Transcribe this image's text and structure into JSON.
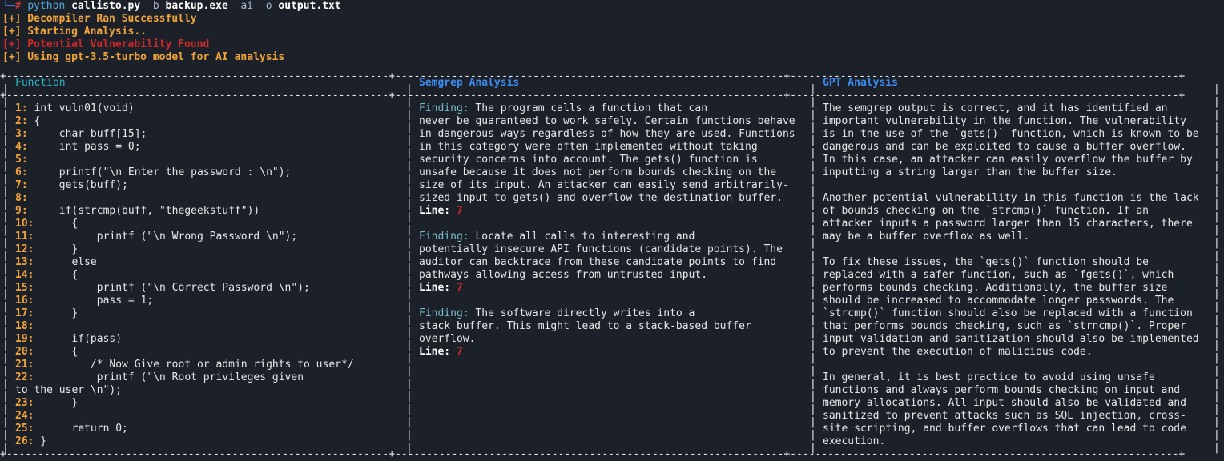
{
  "prompt": {
    "corner": "└─",
    "hash": "#",
    "program": "python",
    "script": "callisto.py",
    "flag_b": "-b",
    "target": "backup.exe",
    "flag_ai": "-ai",
    "flag_o": "-o",
    "outfile": "output.txt"
  },
  "status_messages": [
    {
      "text": "[+] Decompiler Ran Successfully",
      "color": "orange"
    },
    {
      "text": "[+] Starting Analysis..",
      "color": "orange"
    },
    {
      "text": "[+] Potential Vulnerability Found",
      "color": "red"
    },
    {
      "text": "[+] Using gpt-3.5-turbo model for AI analysis",
      "color": "orange"
    }
  ],
  "table": {
    "headers": {
      "function": "Function",
      "semgrep": "Semgrep Analysis",
      "gpt": "GPT Analysis"
    }
  },
  "function_code": [
    {
      "n": "1:",
      "t": " int vuln01(void)"
    },
    {
      "n": "2:",
      "t": " {"
    },
    {
      "n": "3:",
      "t": "     char buff[15];"
    },
    {
      "n": "4:",
      "t": "     int pass = 0;"
    },
    {
      "n": "5:",
      "t": ""
    },
    {
      "n": "6:",
      "t": "     printf(\"\\n Enter the password : \\n\");"
    },
    {
      "n": "7:",
      "t": "     gets(buff);"
    },
    {
      "n": "8:",
      "t": ""
    },
    {
      "n": "9:",
      "t": "     if(strcmp(buff, \"thegeekstuff\"))"
    },
    {
      "n": "10:",
      "t": "      {"
    },
    {
      "n": "11:",
      "t": "          printf (\"\\n Wrong Password \\n\");"
    },
    {
      "n": "12:",
      "t": "      }"
    },
    {
      "n": "13:",
      "t": "      else"
    },
    {
      "n": "14:",
      "t": "      {"
    },
    {
      "n": "15:",
      "t": "          printf (\"\\n Correct Password \\n\");"
    },
    {
      "n": "16:",
      "t": "          pass = 1;"
    },
    {
      "n": "17:",
      "t": "      }"
    },
    {
      "n": "18:",
      "t": ""
    },
    {
      "n": "19:",
      "t": "      if(pass)"
    },
    {
      "n": "20:",
      "t": "      {"
    },
    {
      "n": "21:",
      "t": "         /* Now Give root or admin rights to user*/"
    },
    {
      "n": "22:",
      "t": "          printf (\"\\n Root privileges given"
    },
    {
      "n": "",
      "t": "to the user \\n\");"
    },
    {
      "n": "23:",
      "t": "      }"
    },
    {
      "n": "24:",
      "t": ""
    },
    {
      "n": "25:",
      "t": "      return 0;"
    },
    {
      "n": "26:",
      "t": " }"
    }
  ],
  "semgrep_findings": [
    {
      "label": "Finding:",
      "first": " The program calls a function that can",
      "rest": [
        "never be guaranteed to work safely. Certain functions behave",
        "in dangerous ways regardless of how they are used. Functions",
        "in this category were often implemented without taking",
        "security concerns into account. The gets() function is",
        "unsafe because it does not perform bounds checking on the",
        "size of its input. An attacker can easily send arbitrarily-",
        "sized input to gets() and overflow the destination buffer."
      ],
      "line_label": "Line:",
      "line_value": "7"
    },
    {
      "label": "Finding:",
      "first": " Locate all calls to interesting and",
      "rest": [
        "potentially insecure API functions (candidate points). The",
        "auditor can backtrace from these candidate points to find",
        "pathways allowing access from untrusted input."
      ],
      "line_label": "Line:",
      "line_value": "7"
    },
    {
      "label": "Finding:",
      "first": " The software directly writes into a",
      "rest": [
        "stack buffer. This might lead to a stack-based buffer",
        "overflow."
      ],
      "line_label": "Line:",
      "line_value": "7"
    }
  ],
  "gpt_analysis": [
    "The semgrep output is correct, and it has identified an",
    "important vulnerability in the function. The vulnerability",
    "is in the use of the `gets()` function, which is known to be",
    "dangerous and can be exploited to cause a buffer overflow.",
    "In this case, an attacker can easily overflow the buffer by",
    "inputting a string larger than the buffer size.",
    "",
    "Another potential vulnerability in this function is the lack",
    "of bounds checking on the `strcmp()` function. If an",
    "attacker inputs a password larger than 15 characters, there",
    "may be a buffer overflow as well.",
    "",
    "To fix these issues, the `gets()` function should be",
    "replaced with a safer function, such as `fgets()`, which",
    "performs bounds checking. Additionally, the buffer size",
    "should be increased to accommodate longer passwords. The",
    "`strcmp()` function should also be replaced with a function",
    "that performs bounds checking, such as `strncmp()`. Proper",
    "input validation and sanitization should also be implemented",
    "to prevent the execution of malicious code.",
    "",
    "In general, it is best practice to avoid using unsafe",
    "functions and always perform bounds checking on input and",
    "memory allocations. All input should also be validated and",
    "sanitized to prevent attacks such as SQL injection, cross-",
    "site scripting, and buffer overflows that can lead to code",
    "execution."
  ]
}
